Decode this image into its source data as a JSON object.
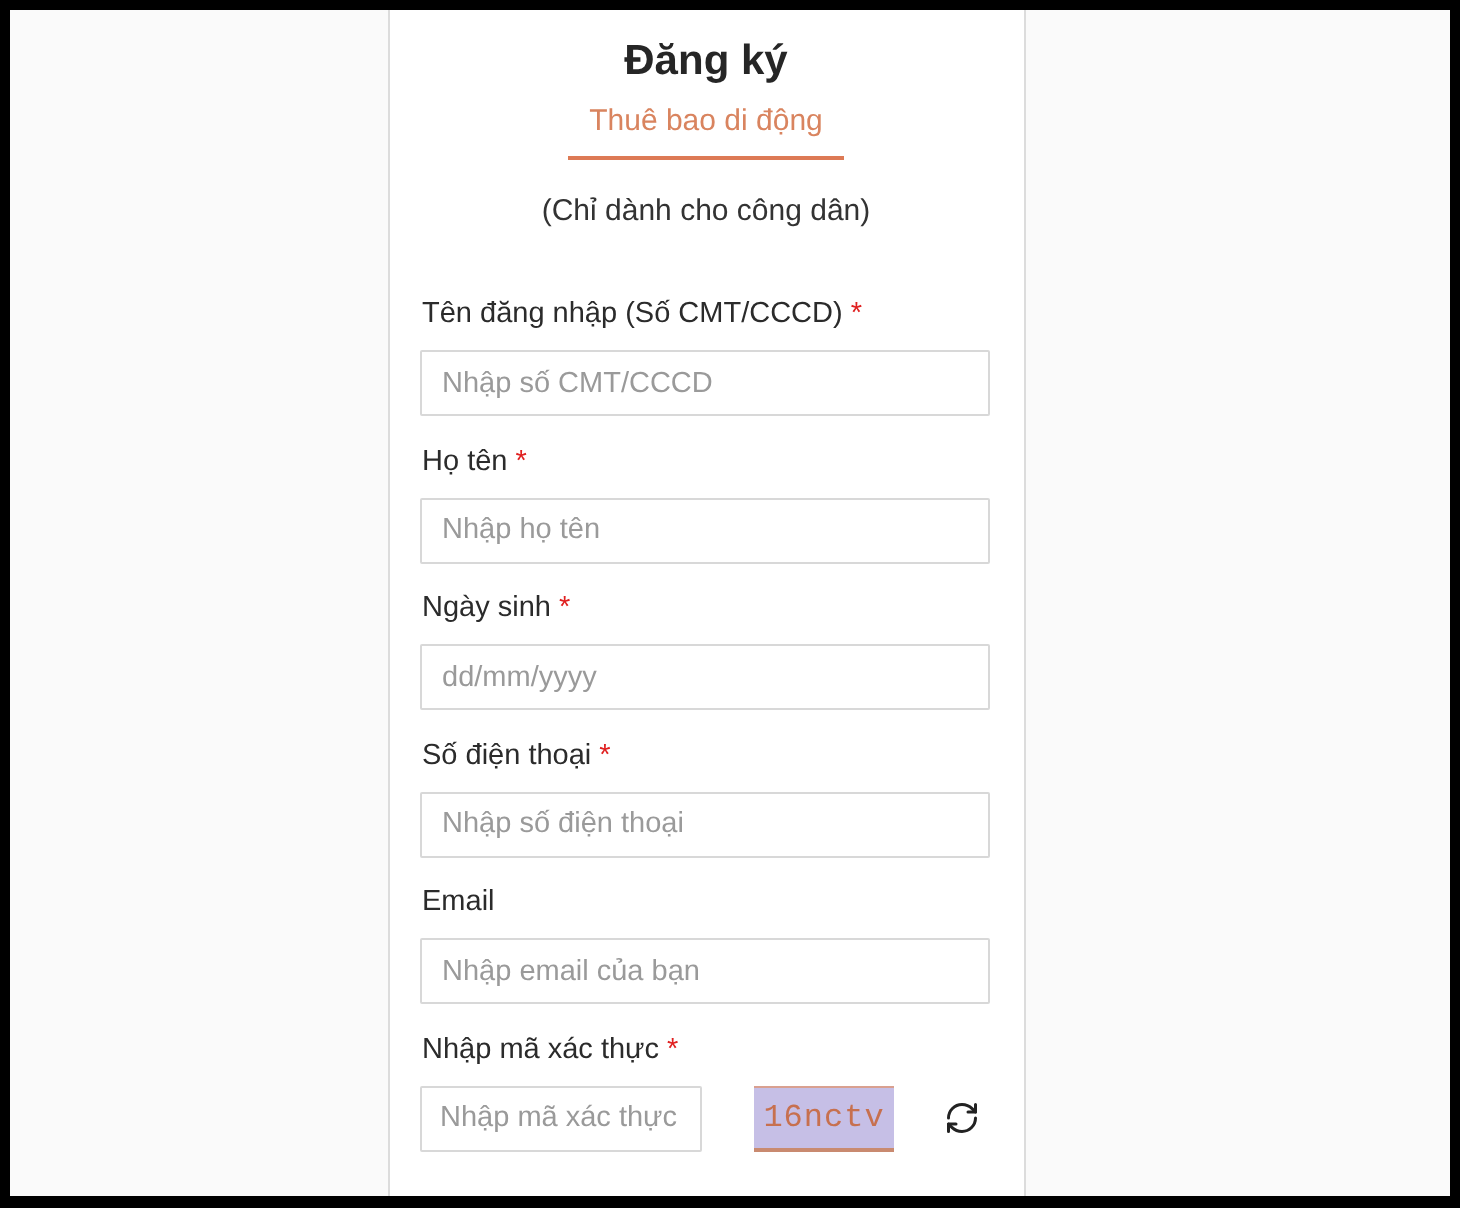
{
  "header": {
    "title": "Đăng ký",
    "tabs": [
      {
        "label": "Thuê bao di động",
        "selected": true
      }
    ],
    "note": "(Chỉ dành cho công dân)"
  },
  "form": {
    "required_mark": "*",
    "fields": [
      {
        "label": "Tên đăng nhập (Số CMT/CCCD)",
        "required": true,
        "placeholder": "Nhập số CMT/CCCD"
      },
      {
        "label": "Họ tên",
        "required": true,
        "placeholder": "Nhập họ tên"
      },
      {
        "label": "Ngày sinh",
        "required": true,
        "placeholder": "dd/mm/yyyy"
      },
      {
        "label": "Số điện thoại",
        "required": true,
        "placeholder": "Nhập số điện thoại"
      },
      {
        "label": "Email",
        "required": false,
        "placeholder": "Nhập email của bạn"
      }
    ]
  },
  "captcha": {
    "label": "Nhập mã xác thực",
    "required": true,
    "placeholder": "Nhập mã xác thực",
    "code": "16nctv"
  }
}
